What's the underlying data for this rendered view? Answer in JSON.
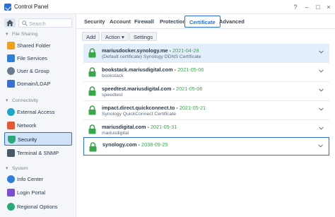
{
  "window": {
    "title": "Control Panel",
    "help_icon": "?",
    "minimize_icon": "–",
    "maximize_icon": "□",
    "close_icon": "×"
  },
  "sidebar": {
    "search_placeholder": "Search",
    "sections": [
      {
        "header": "File Sharing",
        "items": [
          {
            "label": "Shared Folder",
            "icon": "folder-icon",
            "color": "#f0a020"
          },
          {
            "label": "File Services",
            "icon": "file-services-icon",
            "color": "#2f7fd8"
          },
          {
            "label": "User & Group",
            "icon": "user-group-icon",
            "color": "#6b7a8c"
          },
          {
            "label": "Domain/LDAP",
            "icon": "domain-icon",
            "color": "#3c6fd0"
          }
        ]
      },
      {
        "header": "Connectivity",
        "items": [
          {
            "label": "External Access",
            "icon": "globe-icon",
            "color": "#21a4c8"
          },
          {
            "label": "Network",
            "icon": "network-icon",
            "color": "#e05a3a"
          },
          {
            "label": "Security",
            "icon": "shield-icon",
            "color": "#2aa879",
            "active": true
          },
          {
            "label": "Terminal & SNMP",
            "icon": "terminal-icon",
            "color": "#4a5968"
          }
        ]
      },
      {
        "header": "System",
        "items": [
          {
            "label": "Info Center",
            "icon": "info-icon",
            "color": "#2f7fd8"
          },
          {
            "label": "Login Portal",
            "icon": "login-portal-icon",
            "color": "#7b4fd0"
          },
          {
            "label": "Regional Options",
            "icon": "regional-icon",
            "color": "#2aa879"
          }
        ]
      }
    ]
  },
  "tabs": [
    "Security",
    "Account",
    "Firewall",
    "Protection",
    "Certificate",
    "Advanced"
  ],
  "active_tab": "Certificate",
  "toolbar": {
    "add": "Add",
    "action": "Action",
    "settings": "Settings"
  },
  "certificates": [
    {
      "name": "mariusdocker.synology.me",
      "date": "2021-04-28",
      "sub": "(Default certificate) Synology DDNS Certificate",
      "selected": true
    },
    {
      "name": "bookstack.mariusdigital.com",
      "date": "2021-05-06",
      "sub": "bookstack"
    },
    {
      "name": "speedtest.mariusdigital.com",
      "date": "2021-05-06",
      "sub": "speedtest"
    },
    {
      "name": "impact.direct.quickconnect.to",
      "date": "2021-05-21",
      "sub": "Synology QuickConnect Certificate"
    },
    {
      "name": "mariusdigital.com",
      "date": "2021-05-31",
      "sub": "mariusdigital"
    },
    {
      "name": "synology.com",
      "date": "2038-09-25",
      "sub": "",
      "framed": true
    }
  ],
  "colors": {
    "accent": "#2b6fd6",
    "valid": "#3aa64b",
    "selected_row": "#e3eefb"
  }
}
